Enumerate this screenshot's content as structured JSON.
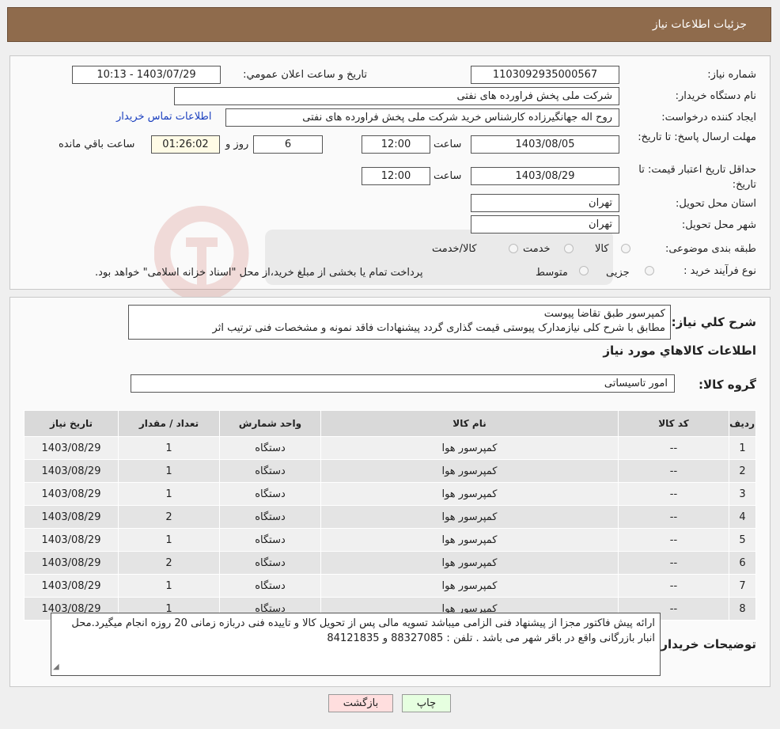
{
  "header": {
    "title": "جزئیات اطلاعات نیاز"
  },
  "form": {
    "need_number_label": "شماره نیاز:",
    "need_number": "1103092935000567",
    "announce_label": "تاریخ و ساعت اعلان عمومي:",
    "announce_value": "1403/07/29 - 10:13",
    "buyer_org_label": "نام دستگاه خريدار:",
    "buyer_org": "شرکت ملی پخش فراورده های نفتی",
    "requester_label": "ايجاد کننده درخواست:",
    "requester": "روح اله جهانگیرزاده کارشناس خرید شرکت ملی پخش فراورده های نفتی",
    "contact_link": "اطلاعات تماس خريدار",
    "deadline_label": "مهلت ارسال پاسخ: تا تاريخ:",
    "deadline_date": "1403/08/05",
    "hour_label": "ساعت",
    "deadline_hour": "12:00",
    "days_value": "6",
    "days_label": "روز و",
    "remaining_time": "01:26:02",
    "remaining_label": "ساعت باقي مانده",
    "validity_label": "حداقل تاريخ اعتبار قيمت: تا تاريخ:",
    "validity_date": "1403/08/29",
    "validity_hour": "12:00",
    "province_label": "استان محل تحويل:",
    "province": "تهران",
    "city_label": "شهر محل تحويل:",
    "city": "تهران",
    "category_label": "طبقه بندی موضوعی:",
    "category_options": [
      "کالا",
      "خدمت",
      "کالا/خدمت"
    ],
    "process_label": "نوع فرآيند خريد :",
    "process_options": [
      "جزیی",
      "متوسط"
    ],
    "process_note": "پرداخت تمام یا بخشی از مبلغ خرید،از محل \"اسناد خزانه اسلامی\" خواهد بود."
  },
  "details": {
    "summary_label": "شرح کلي نياز:",
    "summary_line1": "کمپرسور طبق تقاضا پیوست",
    "summary_line2": "مطابق با شرح کلی نیازمدارک پیوستی قیمت گذاری گردد پیشنهادات فاقد نمونه و مشخصات فنی ترتیب اثر",
    "goods_info_title": "اطلاعات کالاهاي مورد نياز",
    "goods_group_label": "گروه کالا:",
    "goods_group": "امور تاسیساتی"
  },
  "table": {
    "headers": [
      "رديف",
      "کد کالا",
      "نام کالا",
      "واحد شمارش",
      "تعداد / مقدار",
      "تاريخ نياز"
    ],
    "rows": [
      [
        "1",
        "--",
        "کمپرسور هوا",
        "دستگاه",
        "1",
        "1403/08/29"
      ],
      [
        "2",
        "--",
        "کمپرسور هوا",
        "دستگاه",
        "1",
        "1403/08/29"
      ],
      [
        "3",
        "--",
        "کمپرسور هوا",
        "دستگاه",
        "1",
        "1403/08/29"
      ],
      [
        "4",
        "--",
        "کمپرسور هوا",
        "دستگاه",
        "2",
        "1403/08/29"
      ],
      [
        "5",
        "--",
        "کمپرسور هوا",
        "دستگاه",
        "1",
        "1403/08/29"
      ],
      [
        "6",
        "--",
        "کمپرسور هوا",
        "دستگاه",
        "2",
        "1403/08/29"
      ],
      [
        "7",
        "--",
        "کمپرسور هوا",
        "دستگاه",
        "1",
        "1403/08/29"
      ],
      [
        "8",
        "--",
        "کمپرسور هوا",
        "دستگاه",
        "1",
        "1403/08/29"
      ]
    ]
  },
  "notes": {
    "label": "توضيحات خريدار:",
    "text": "ارائه پیش فاکتور مجزا از پیشنهاد فنی الزامی میباشد تسویه مالی پس از تحویل کالا و تاییده فنی دربازه زمانی 20 روزه انجام میگیرد.محل انبار بازرگانی واقع در باقر شهر می باشد . تلفن : 88327085 و 84121835"
  },
  "buttons": {
    "back": "بازگشت",
    "print": "چاپ"
  },
  "colors": {
    "header_bg": "#8f6b4c",
    "link": "#1a3fbf",
    "back_btn": "#ffdede",
    "print_btn": "#e6ffe0"
  }
}
